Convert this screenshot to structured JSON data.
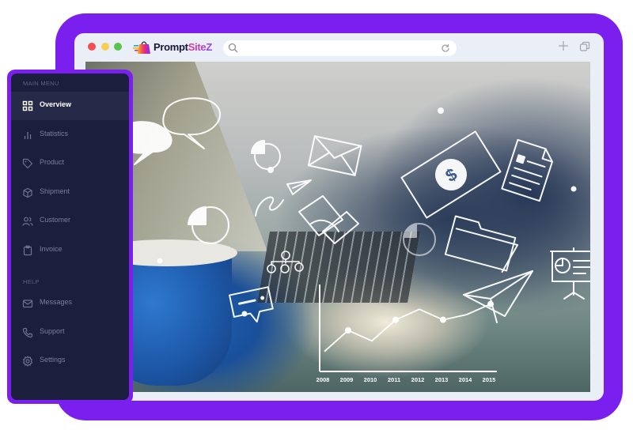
{
  "colors": {
    "frame": "#7b1fee",
    "browser_chrome": "#eaeef6",
    "sidebar_bg": "#1c1e3e",
    "sidebar_active_bg": "#262947",
    "traffic_red": "#f0504f",
    "traffic_yellow": "#f6cf52",
    "traffic_green": "#58c54a"
  },
  "browser": {
    "logo": {
      "text_main": "Prompt",
      "text_accent": "SiteZ",
      "icon": "shopping-bag-icon"
    },
    "address_bar": {
      "value": "",
      "placeholder": "",
      "search_icon": "search-icon",
      "reload_icon": "reload-icon"
    },
    "new_tab_icon": "plus-icon",
    "tabs_icon": "tabs-overview-icon"
  },
  "sidebar": {
    "sections": [
      {
        "label": "MAIN MENU",
        "items": [
          {
            "label": "Overview",
            "icon": "grid-icon",
            "active": true
          },
          {
            "label": "Statistics",
            "icon": "bar-chart-icon",
            "active": false
          },
          {
            "label": "Product",
            "icon": "tag-icon",
            "active": false
          },
          {
            "label": "Shipment",
            "icon": "box-icon",
            "active": false
          },
          {
            "label": "Customer",
            "icon": "users-icon",
            "active": false
          },
          {
            "label": "Invoice",
            "icon": "clipboard-icon",
            "active": false
          }
        ]
      },
      {
        "label": "HELP",
        "items": [
          {
            "label": "Messages",
            "icon": "mail-icon",
            "active": false
          },
          {
            "label": "Support",
            "icon": "phone-icon",
            "active": false
          },
          {
            "label": "Settings",
            "icon": "gear-icon",
            "active": false
          }
        ]
      }
    ]
  },
  "hero_image": {
    "description": "Business person typing on laptop with blue mug, overlaid with digital business icons and a growth line chart",
    "overlay_icons": [
      "speech-bubbles-icon",
      "pie-chart-icon",
      "envelope-icon",
      "dollar-bill-icon",
      "document-icon",
      "paper-plane-icon",
      "handshake-icon",
      "folder-icon",
      "presentation-board-icon",
      "chat-icon",
      "network-icon"
    ],
    "overlay_chart": {
      "x_labels": [
        "2008",
        "2009",
        "2010",
        "2011",
        "2012",
        "2013",
        "2014",
        "2015"
      ],
      "values": [
        1,
        3,
        2,
        4,
        5,
        4,
        4.5,
        5.5
      ]
    }
  }
}
